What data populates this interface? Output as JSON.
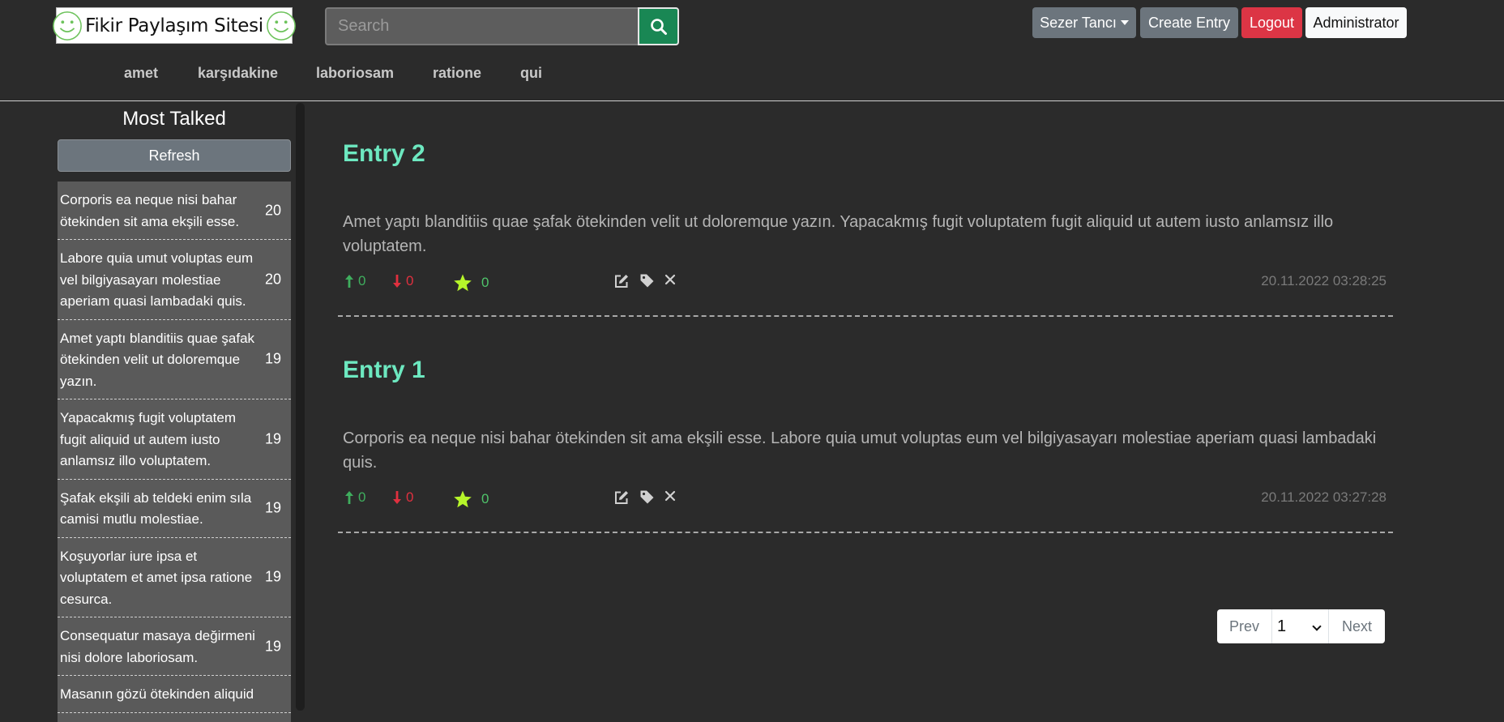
{
  "header": {
    "logo_text": "Fikir Paylaşım Sitesi",
    "search_placeholder": "Search",
    "user_menu": "Sezer Tancı",
    "create_entry": "Create Entry",
    "logout": "Logout",
    "admin": "Administrator"
  },
  "categories": [
    "amet",
    "karşıdakine",
    "laboriosam",
    "ratione",
    "qui"
  ],
  "sidebar": {
    "title": "Most Talked",
    "refresh": "Refresh",
    "items": [
      {
        "text": "Corporis ea neque nisi bahar ötekinden sit ama ekşili esse.",
        "count": "20"
      },
      {
        "text": "Labore quia umut voluptas eum vel bilgiyasayarı molestiae aperiam quasi lambadaki quis.",
        "count": "20"
      },
      {
        "text": "Amet yaptı blanditiis quae şafak ötekinden velit ut doloremque yazın.",
        "count": "19"
      },
      {
        "text": "Yapacakmış fugit voluptatem fugit aliquid ut autem iusto anlamsız illo voluptatem.",
        "count": "19"
      },
      {
        "text": "Şafak ekşili ab teldeki enim sıla camisi mutlu molestiae.",
        "count": "19"
      },
      {
        "text": "Koşuyorlar iure ipsa et voluptatem et amet ipsa ratione cesurca.",
        "count": "19"
      },
      {
        "text": "Consequatur masaya değirmeni nisi dolore laboriosam.",
        "count": "19"
      },
      {
        "text": "Masanın gözü ötekinden aliquid",
        "count": ""
      }
    ]
  },
  "entries": [
    {
      "title": "Entry 2",
      "body": "Amet yaptı blanditiis quae şafak ötekinden velit ut doloremque yazın. Yapacakmış fugit voluptatem fugit aliquid ut autem iusto anlamsız illo voluptatem.",
      "upvotes": "0",
      "downvotes": "0",
      "favorites": "0",
      "date": "20.11.2022 03:28:25"
    },
    {
      "title": "Entry 1",
      "body": "Corporis ea neque nisi bahar ötekinden sit ama ekşili esse. Labore quia umut voluptas eum vel bilgiyasayarı molestiae aperiam quasi lambadaki quis.",
      "upvotes": "0",
      "downvotes": "0",
      "favorites": "0",
      "date": "20.11.2022 03:27:28"
    }
  ],
  "pagination": {
    "prev": "Prev",
    "page": "1",
    "next": "Next"
  },
  "colors": {
    "background": "#2b2b2b",
    "entry_title": "#6de8c0",
    "upvote": "#3fae5e",
    "downvote": "#e0303f",
    "star": "#b6f52a",
    "search_button": "#198754",
    "logout": "#dc3545"
  },
  "icons": [
    "smiley-icon",
    "search-icon",
    "arrow-up-icon",
    "arrow-down-icon",
    "star-icon",
    "edit-icon",
    "tag-icon",
    "close-icon",
    "chevron-down-icon"
  ]
}
